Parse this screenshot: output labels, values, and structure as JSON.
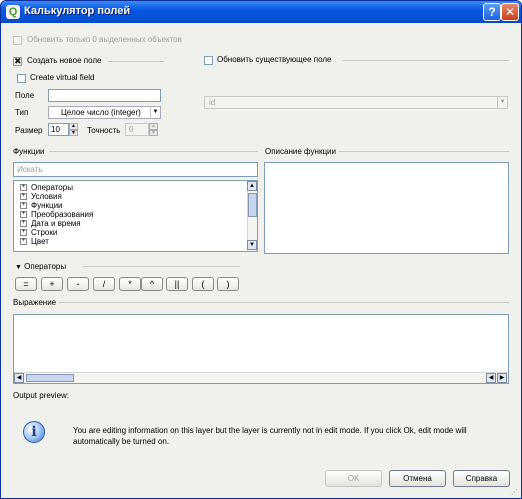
{
  "window": {
    "title": "Калькулятор полей",
    "help_glyph": "?",
    "close_glyph": "✕",
    "app_glyph": "Q"
  },
  "update_selected_only": {
    "label": "Обновить только 0 выделенных объектов",
    "checked": false
  },
  "create_new_field": {
    "label": "Создать новое поле",
    "checked": true,
    "virtual_label": "Create virtual field",
    "field_label": "Поле",
    "field_value": "",
    "type_label": "Тип",
    "type_value": "Целое число (integer)",
    "size_label": "Размер",
    "size_value": "10",
    "precision_label": "Точность",
    "precision_value": "0"
  },
  "update_existing": {
    "label": "Обновить существующее поле",
    "checked": false,
    "field_value": "id"
  },
  "functions": {
    "section_label": "Функции",
    "search_placeholder": "Искать",
    "items": [
      "Операторы",
      "Условия",
      "Функции",
      "Преобразования",
      "Дата и время",
      "Строки",
      "Цвет"
    ]
  },
  "function_description": {
    "section_label": "Описание функции"
  },
  "operators": {
    "section_label": "Операторы",
    "buttons": [
      "=",
      "+",
      "-",
      "/",
      "*",
      "^",
      "||",
      "(",
      ")"
    ]
  },
  "expression": {
    "section_label": "Выражение",
    "value": ""
  },
  "output_preview": {
    "label": "Output preview:",
    "value": ""
  },
  "info": {
    "icon": "info-icon",
    "message": "You are editing information on this layer but the layer is currently not in edit mode. If you click Ok, edit mode will automatically be turned on."
  },
  "footer": {
    "ok_label": "OK",
    "cancel_label": "Отмена",
    "help_label": "Справка"
  },
  "colors": {
    "titlebar": "#0451d6",
    "dialog_bg": "#f0f0ec",
    "info_icon": "#2f6fd0"
  }
}
